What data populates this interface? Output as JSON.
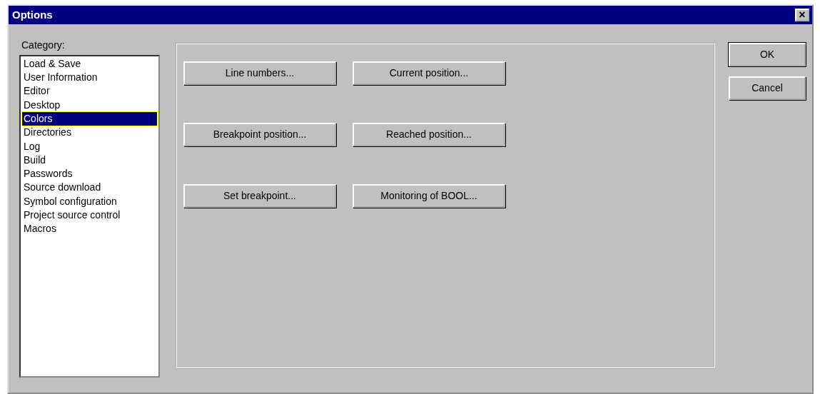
{
  "window": {
    "title": "Options",
    "close": "×"
  },
  "category": {
    "label": "Category:",
    "items": [
      {
        "label": "Load & Save",
        "selected": false
      },
      {
        "label": "User Information",
        "selected": false
      },
      {
        "label": "Editor",
        "selected": false
      },
      {
        "label": "Desktop",
        "selected": false
      },
      {
        "label": "Colors",
        "selected": true
      },
      {
        "label": "Directories",
        "selected": false
      },
      {
        "label": "Log",
        "selected": false
      },
      {
        "label": "Build",
        "selected": false
      },
      {
        "label": "Passwords",
        "selected": false
      },
      {
        "label": "Source download",
        "selected": false
      },
      {
        "label": "Symbol configuration",
        "selected": false
      },
      {
        "label": "Project source control",
        "selected": false
      },
      {
        "label": "Macros",
        "selected": false
      }
    ]
  },
  "color_buttons": [
    [
      "Line numbers...",
      "Current position..."
    ],
    [
      "Breakpoint position...",
      "Reached position..."
    ],
    [
      "Set breakpoint...",
      "Monitoring of BOOL..."
    ]
  ],
  "buttons": [
    {
      "label": "OK",
      "default": true
    },
    {
      "label": "Cancel",
      "default": false
    }
  ]
}
